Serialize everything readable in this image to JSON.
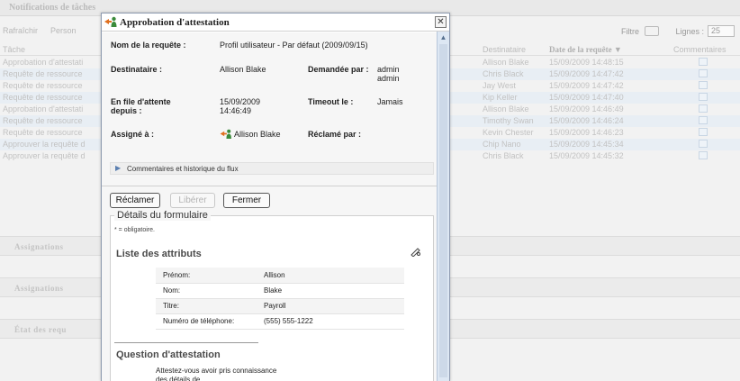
{
  "background": {
    "header_title": "Notifications de tâches",
    "toolbar": {
      "refresh": "Rafraîchir",
      "person": "Person",
      "filter": "Filtre",
      "lines_label": "Lignes :",
      "lines_value": "25"
    },
    "columns": {
      "task": "Tâche",
      "recipient": "Destinataire",
      "date": "Date de la requête",
      "comments": "Commentaires"
    },
    "rows": [
      {
        "task": "Approbation d'attestati",
        "recipient": "Allison Blake",
        "date": "15/09/2009 14:48:15"
      },
      {
        "task": "Requête de ressource",
        "recipient": "Chris Black",
        "date": "15/09/2009 14:47:42"
      },
      {
        "task": "Requête de ressource",
        "recipient": "Jay West",
        "date": "15/09/2009 14:47:42"
      },
      {
        "task": "Requête de ressource",
        "recipient": "Kip Keller",
        "date": "15/09/2009 14:47:40"
      },
      {
        "task": "Approbation d'attestati",
        "recipient": "Allison Blake",
        "date": "15/09/2009 14:46:49"
      },
      {
        "task": "Requête de ressource",
        "recipient": "Timothy Swan",
        "date": "15/09/2009 14:46:24"
      },
      {
        "task": "Requête de ressource",
        "recipient": "Kevin Chester",
        "date": "15/09/2009 14:46:23"
      },
      {
        "task": "Approuver la requête d",
        "recipient": "Chip Nano",
        "date": "15/09/2009 14:45:34"
      },
      {
        "task": "Approuver la requête d",
        "recipient": "Chris Black",
        "date": "15/09/2009 14:45:32"
      }
    ],
    "sections": [
      "Assignations",
      "Assignations",
      "État des requ"
    ]
  },
  "dialog": {
    "title": "Approbation d'attestation",
    "close": "✕",
    "fields": {
      "request_name_label": "Nom de la requête :",
      "request_name_value": "Profil utilisateur - Par défaut (2009/09/15)",
      "recipient_label": "Destinataire :",
      "recipient_value": "Allison Blake",
      "requested_by_label": "Demandée par :",
      "requested_by_value": "admin admin",
      "queued_label": "En file d'attente depuis :",
      "queued_value": "15/09/2009 14:46:49",
      "timeout_label": "Timeout le :",
      "timeout_value": "Jamais",
      "assigned_label": "Assigné à :",
      "assigned_value": "Allison Blake",
      "claimed_label": "Réclamé par :",
      "claimed_value": ""
    },
    "flux_label": "Commentaires et historique du flux",
    "buttons": {
      "claim": "Réclamer",
      "release": "Libérer",
      "close": "Fermer"
    },
    "form": {
      "legend": "Détails du formulaire",
      "required_note": "* = obligatoire.",
      "attributes_title": "Liste des attributs",
      "attributes": [
        {
          "key": "Prénom:",
          "value": "Allison"
        },
        {
          "key": "Nom:",
          "value": "Blake"
        },
        {
          "key": "Titre:",
          "value": "Payroll"
        },
        {
          "key": "Numéro de téléphone:",
          "value": "(555) 555-1222"
        }
      ],
      "question_title": "Question d'attestation",
      "question_text": "Attestez-vous avoir pris connaissance des détails de"
    }
  }
}
